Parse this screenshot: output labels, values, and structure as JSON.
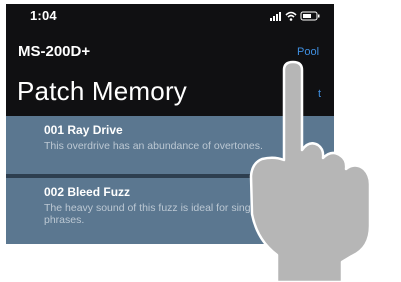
{
  "status_bar": {
    "time": "1:04"
  },
  "nav": {
    "device_name": "MS-200D+",
    "pool_label": "Pool",
    "partial_right_label": "t"
  },
  "page": {
    "title": "Patch Memory"
  },
  "patches": [
    {
      "name": "001 Ray Drive",
      "description": "This overdrive has an abundance of overtones."
    },
    {
      "name": "002 Bleed Fuzz",
      "description": "The heavy sound of this fuzz is ideal for single note phrases."
    }
  ],
  "colors": {
    "screen_background": "#101012",
    "list_background": "#5b7790",
    "link_accent": "#3f8fe0",
    "hand_fill": "#b6b6b6"
  },
  "icons": [
    "signal-icon",
    "wifi-icon",
    "battery-icon",
    "pointing-hand-icon"
  ]
}
